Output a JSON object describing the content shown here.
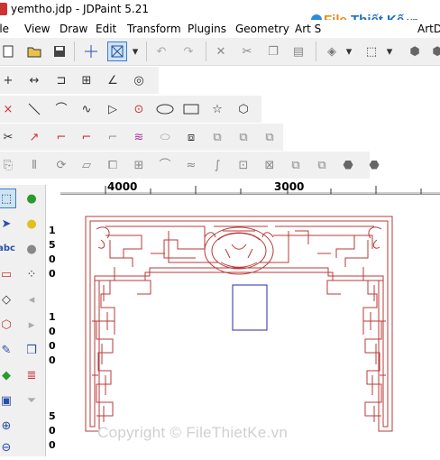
{
  "window": {
    "title": "yemtho.jdp - JDPaint 5.21"
  },
  "watermark": {
    "logo_a": "File",
    "logo_b": "Thiết Kế",
    "logo_c": ".vn",
    "copyright": "Copyright © FileThietKe.vn"
  },
  "menu": [
    "ile",
    "View",
    "Draw",
    "Edit",
    "Transform",
    "Plugins",
    "Geometry",
    "Art S",
    "ArtD"
  ],
  "ruler": {
    "h_labels": [
      "4000",
      "3000"
    ],
    "v_digits": [
      "1",
      "5",
      "0",
      "0",
      "1",
      "0",
      "0",
      "0",
      "5",
      "0",
      "0"
    ]
  },
  "colors": {
    "drawing": "#b83a3a",
    "selection": "#2a2aa8"
  },
  "icons": {
    "row1": [
      "new-file-icon",
      "open-folder-icon",
      "save-icon",
      "snap-cross-icon",
      "select-box-icon",
      "dropdown-icon",
      "undo-icon",
      "redo-icon",
      "cut-icon",
      "scissors-icon",
      "copy-icon",
      "paste-icon",
      "3d-view-icon",
      "dropdown-icon",
      "cube-icon",
      "dropdown-icon",
      "shape-icon",
      "shape-icon",
      "shape-icon"
    ],
    "row2": [
      "point-icon",
      "dimension-icon",
      "align-icon",
      "box-align-icon",
      "angle-icon",
      "sphere-icon"
    ],
    "row3": [
      "cross-icon",
      "line-icon",
      "arc-icon",
      "curve-icon",
      "arrow-icon",
      "circle-icon",
      "ellipse-icon",
      "rectangle-icon",
      "star-icon",
      "polygon-icon"
    ],
    "row4": [
      "scissors-icon",
      "trim-icon",
      "fillet-icon",
      "chamfer-icon",
      "extend-icon",
      "offset-icon",
      "ellipse-icon",
      "spiral-icon",
      "array-icon",
      "array-icon",
      "array-icon"
    ],
    "row5": [
      "transform-icon",
      "mirror-icon",
      "rotate-icon",
      "skew-icon",
      "scale-icon",
      "grid-icon",
      "arc-icon",
      "wave-icon",
      "bend-icon",
      "fit-icon",
      "explode-icon",
      "group-icon",
      "ungroup-icon",
      "shape-icon",
      "shape-icon"
    ]
  }
}
